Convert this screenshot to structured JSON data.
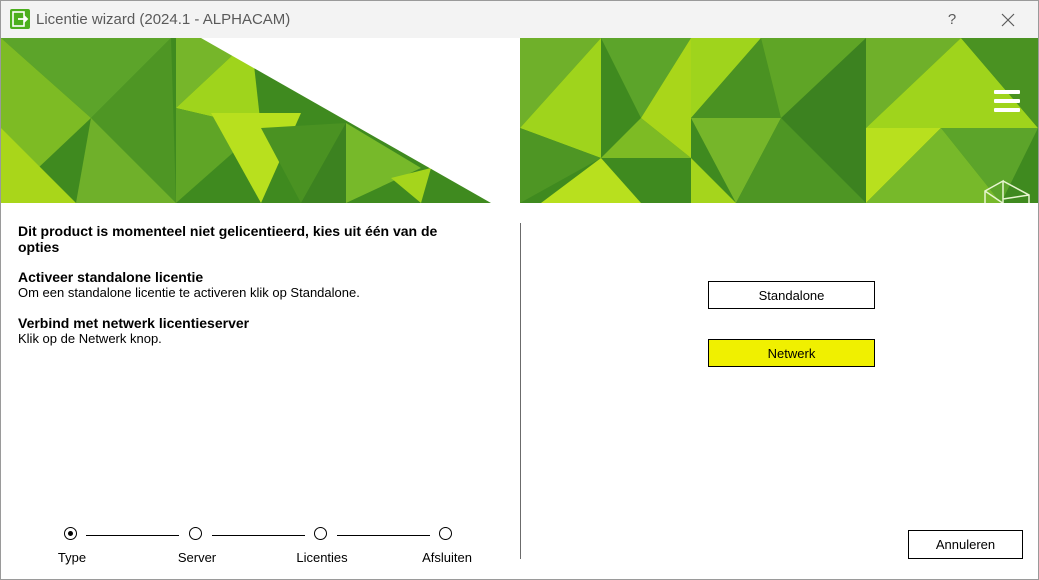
{
  "window": {
    "title": "Licentie wizard (2024.1 - ALPHACAM)",
    "help_label": "?",
    "close_label": "✕"
  },
  "content": {
    "heading": "Dit product is momenteel niet gelicentieerd, kies uit één van de opties",
    "standalone_title": "Activeer standalone licentie",
    "standalone_desc": "Om een standalone licentie te activeren klik op Standalone.",
    "network_title": "Verbind met netwerk licentieserver",
    "network_desc": "Klik op de Netwerk knop."
  },
  "buttons": {
    "standalone": "Standalone",
    "netwerk": "Netwerk",
    "annuleren": "Annuleren"
  },
  "steps": [
    {
      "label": "Type",
      "active": true
    },
    {
      "label": "Server",
      "active": false
    },
    {
      "label": "Licenties",
      "active": false
    },
    {
      "label": "Afsluiten",
      "active": false
    }
  ],
  "colors": {
    "accent_yellow": "#f0f000",
    "banner_green": "#5aa02c",
    "banner_lime": "#9fd41c"
  },
  "icons": [
    "app-license-icon",
    "menu-icon",
    "brand-logo-icon"
  ]
}
